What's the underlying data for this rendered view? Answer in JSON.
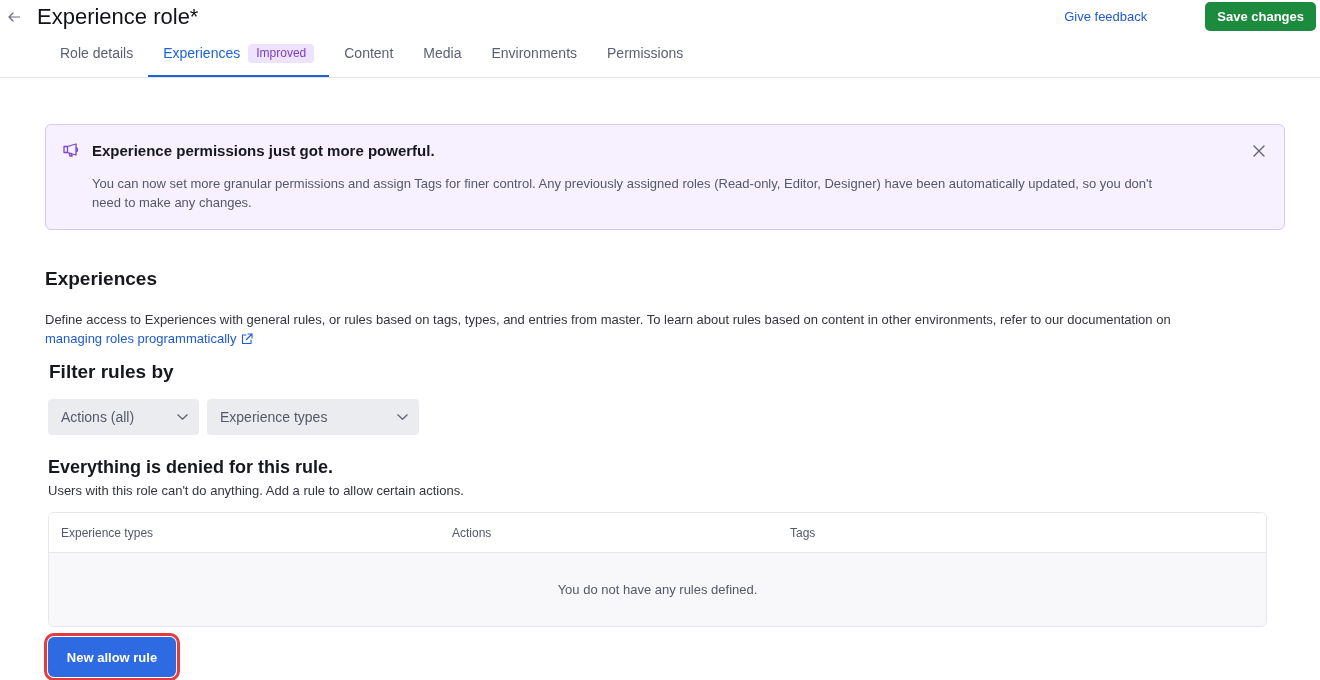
{
  "header": {
    "title": "Experience role*",
    "feedback_link": "Give feedback",
    "save_button": "Save changes"
  },
  "tabs": [
    {
      "label": "Role details",
      "selected": false
    },
    {
      "label": "Experiences",
      "selected": true,
      "badge": "Improved"
    },
    {
      "label": "Content",
      "selected": false
    },
    {
      "label": "Media",
      "selected": false
    },
    {
      "label": "Environments",
      "selected": false
    },
    {
      "label": "Permissions",
      "selected": false
    }
  ],
  "banner": {
    "title": "Experience permissions just got more powerful.",
    "body": "You can now set more granular permissions and assign Tags for finer control. Any previously assigned roles (Read-only, Editor, Designer) have been automatically updated, so you don't need to make any changes."
  },
  "section": {
    "title": "Experiences",
    "description": "Define access to Experiences with general rules, or rules based on tags, types, and entries from master. To learn about rules based on content in other environments, refer to our documentation on",
    "link": "managing roles programmatically"
  },
  "filters": {
    "title": "Filter rules by",
    "dropdowns": [
      {
        "label": "Actions (all)"
      },
      {
        "label": "Experience types"
      }
    ]
  },
  "rules": {
    "title": "Everything is denied for this rule.",
    "subtitle": "Users with this role can't do anything. Add a rule to allow certain actions.",
    "table": {
      "columns": [
        "Experience types",
        "Actions",
        "Tags"
      ],
      "empty_message": "You do not have any rules defined."
    }
  },
  "new_rule_button": {
    "label": "New allow rule",
    "highlighted": true
  }
}
